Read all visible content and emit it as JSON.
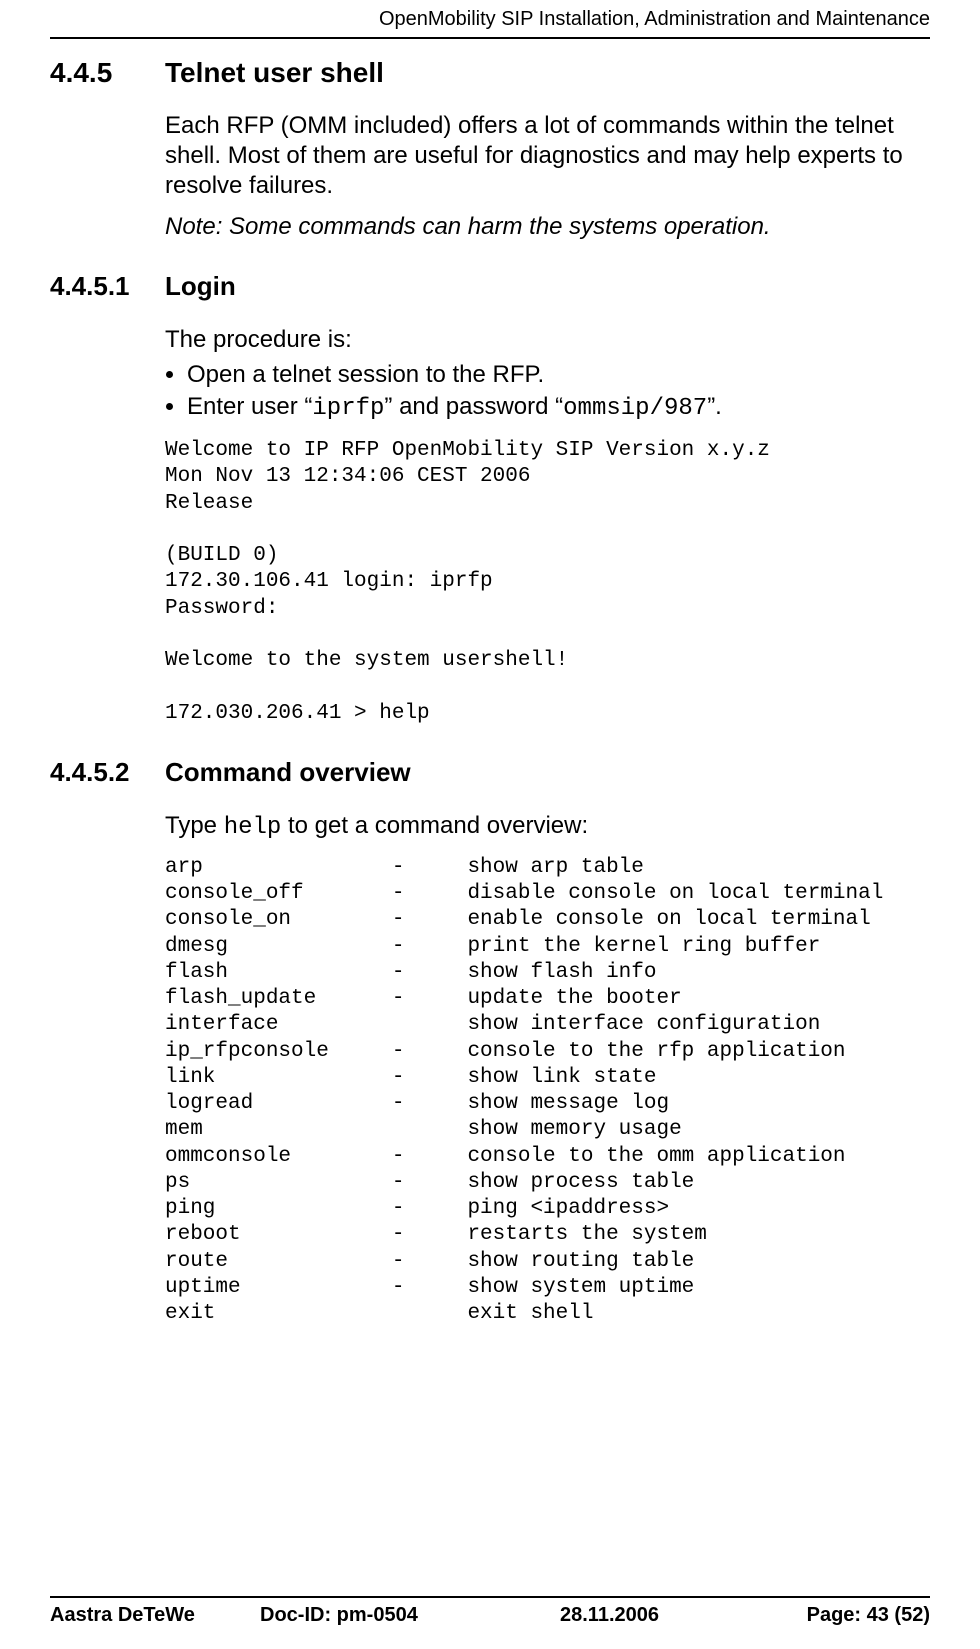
{
  "header": {
    "running_title": "OpenMobility SIP Installation, Administration and Maintenance"
  },
  "sections": {
    "s445": {
      "num": "4.4.5",
      "title": "Telnet user shell"
    },
    "intro": "Each RFP (OMM included) offers a lot of commands within the telnet shell. Most of them are useful for diagnostics and may help experts to resolve failures.",
    "note": "Note: Some commands can harm the systems operation.",
    "s4451": {
      "num": "4.4.5.1",
      "title": "Login"
    },
    "login": {
      "procedure_lead": "The procedure is:",
      "bullet1": "Open a telnet session to the RFP.",
      "bullet2_pre": "Enter user “",
      "bullet2_user": "iprfp",
      "bullet2_mid": "” and password “",
      "bullet2_pass": "ommsip/987",
      "bullet2_post": "”.",
      "console": "Welcome to IP RFP OpenMobility SIP Version x.y.z\nMon Nov 13 12:34:06 CEST 2006\nRelease\n\n(BUILD 0)\n172.30.106.41 login: iprfp\nPassword:\n\nWelcome to the system usershell!\n\n172.030.206.41 > help"
    },
    "s4452": {
      "num": "4.4.5.2",
      "title": "Command overview"
    },
    "cmd_overview": {
      "lead_pre": "Type ",
      "lead_cmd": "help",
      "lead_post": " to get a command overview:",
      "listing": "arp               -     show arp table\nconsole_off       -     disable console on local terminal\nconsole_on        -     enable console on local terminal\ndmesg             -     print the kernel ring buffer\nflash             -     show flash info\nflash_update      -     update the booter\ninterface               show interface configuration\nip_rfpconsole     -     console to the rfp application\nlink              -     show link state\nlogread           -     show message log\nmem                     show memory usage\nommconsole        -     console to the omm application\nps                -     show process table\nping              -     ping <ipaddress>\nreboot            -     restarts the system\nroute             -     show routing table\nuptime            -     show system uptime\nexit                    exit shell"
    }
  },
  "footer": {
    "company": "Aastra DeTeWe",
    "docid": "Doc-ID: pm-0504",
    "date": "28.11.2006",
    "page": "Page: 43 (52)"
  }
}
